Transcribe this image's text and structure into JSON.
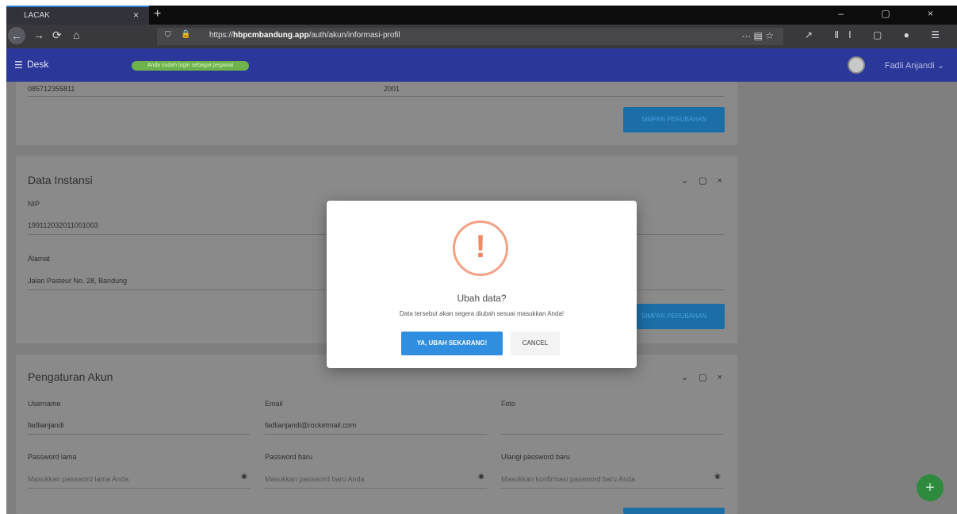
{
  "browser": {
    "tab_title": "LACAK",
    "tab_close": "×",
    "new_tab": "+",
    "window_controls": "– ▢ ×",
    "url_host": "hbpcmbandung.app",
    "url_path": "/auth/akun/informasi-profil",
    "url_prefix": "https://",
    "url_bar_icons": "··· ▤ ☆",
    "toolbar_icons": "↗ ⅡⅠ ▢ ● ☰",
    "nav_icons": {
      "back": "←",
      "forward": "→",
      "reload": "⟳",
      "home": "⌂"
    }
  },
  "header": {
    "menu_icon": "☰",
    "brand": "Desk",
    "status_badge": "Anda sudah login sebagai pegawai",
    "user_name": "Fadli Anjandi",
    "user_caret": "⌄"
  },
  "cards": {
    "top": {
      "value_left": "085712355811",
      "value_mid": "2001",
      "save_label": "SIMPAN PERUBAHAN"
    },
    "instansi": {
      "title": "Data Instansi",
      "controls": "⌄ ▢ ×",
      "nip_label": "NIP",
      "nip_value": "199112032011001003",
      "alamat_label": "Alamat",
      "alamat_value": "Jalan Pasteur No. 28, Bandung",
      "save_label": "SIMPAN PERUBAHAN"
    },
    "akun": {
      "title": "Pengaturan Akun",
      "controls": "⌄ ▢ ×",
      "username_label": "Username",
      "username_value": "fadlianjandi",
      "email_label": "Email",
      "email_value": "fadlianjandi@rocketmail.com",
      "foto_label": "Foto",
      "pw_old_label": "Password lama",
      "pw_old_placeholder": "Masukkan password lama Anda",
      "pw_new_label": "Password baru",
      "pw_new_placeholder": "Masukkan password baru Anda",
      "pw_repeat_label": "Ulangi password baru",
      "pw_repeat_placeholder": "Masukkan konfirmasi password baru Anda",
      "eye_icon": "◉"
    }
  },
  "fab": {
    "label": "+"
  },
  "modal": {
    "icon": "!",
    "title": "Ubah data?",
    "text": "Data tersebut akan segera diubah sesuai masukkan Anda!",
    "confirm_label": "YA, UBAH SEKARANG!",
    "cancel_label": "CANCEL"
  }
}
